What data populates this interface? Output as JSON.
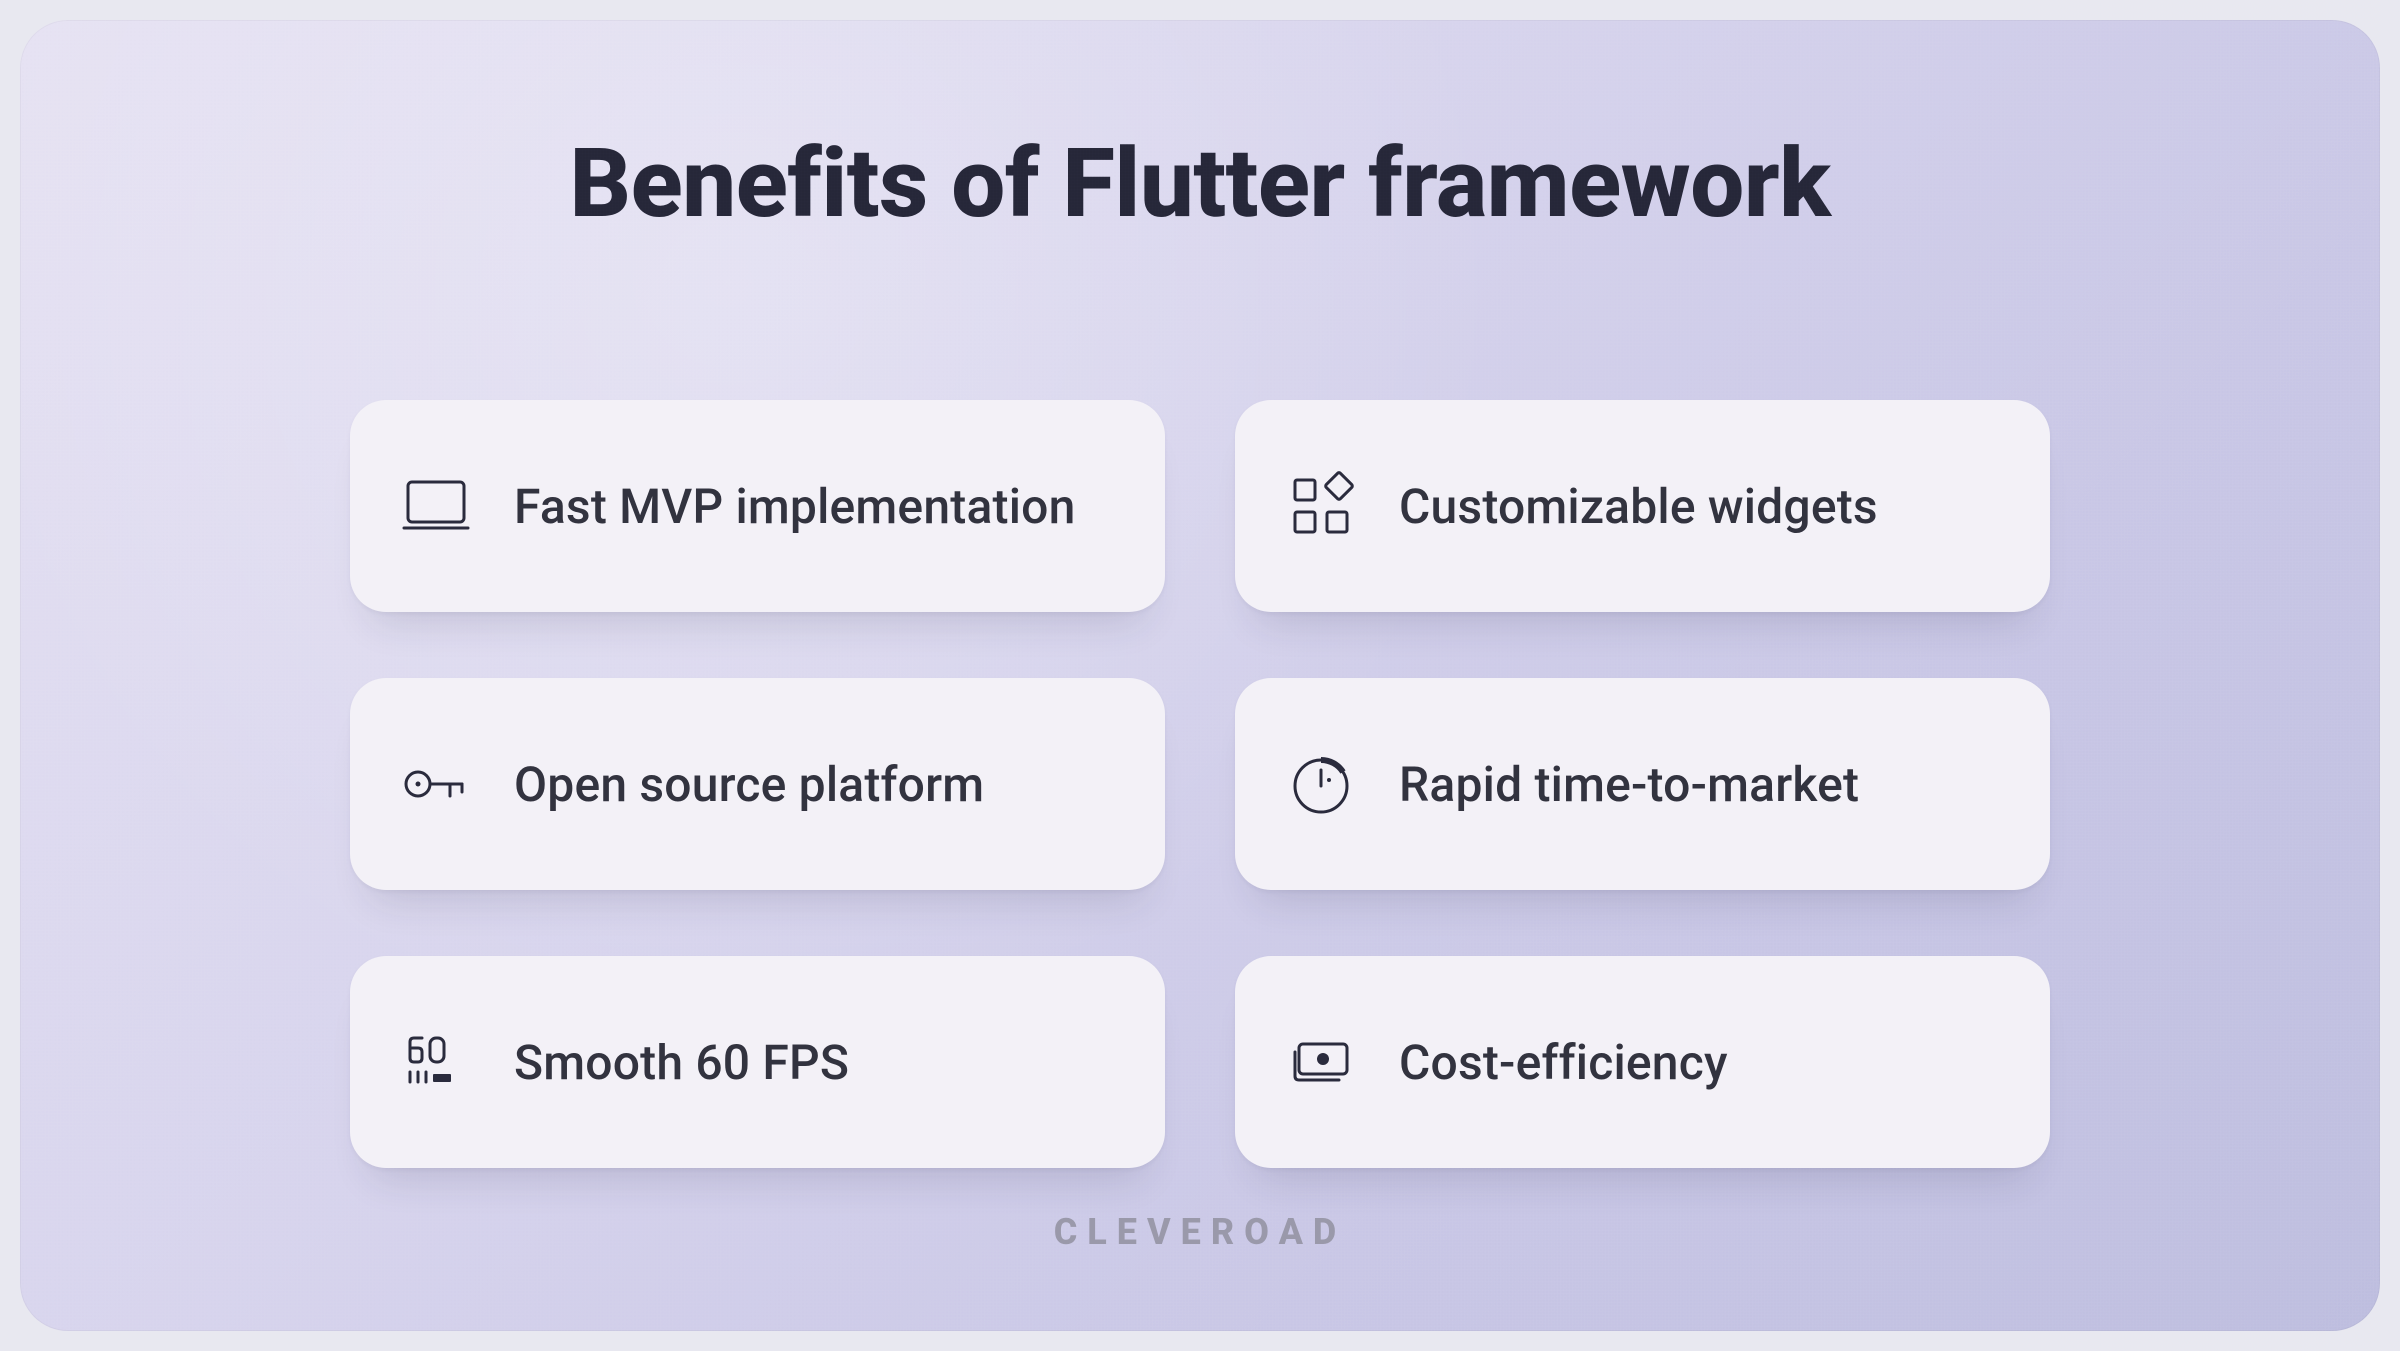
{
  "title": "Benefits of Flutter framework",
  "footer": "CLEVEROAD",
  "cards": [
    {
      "icon": "laptop-icon",
      "label": "Fast MVP implementation"
    },
    {
      "icon": "widgets-icon",
      "label": "Customizable widgets"
    },
    {
      "icon": "key-icon",
      "label": "Open source platform"
    },
    {
      "icon": "timer-icon",
      "label": "Rapid time-to-market"
    },
    {
      "icon": "fps-icon",
      "label": "Smooth 60 FPS"
    },
    {
      "icon": "money-icon",
      "label": "Cost-efficiency"
    }
  ]
}
